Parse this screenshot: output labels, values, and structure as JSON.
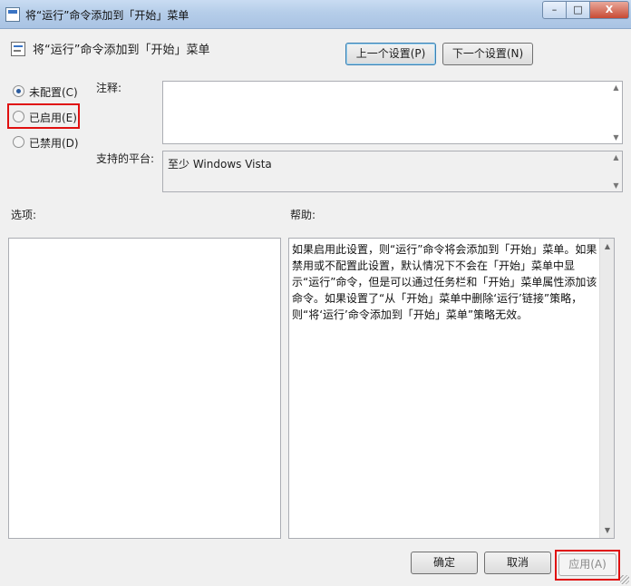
{
  "window": {
    "title": "将“运行”命令添加到「开始」菜单",
    "minimize_label": "–",
    "maximize_label": "□",
    "close_label": "X",
    "icon": "policy-window-icon"
  },
  "header": {
    "policy_title": "将“运行”命令添加到「开始」菜单",
    "policy_icon": "policy-icon",
    "prev_button": "上一个设置(P)",
    "next_button": "下一个设置(N)"
  },
  "state": {
    "options": [
      {
        "label": "未配置(C)",
        "checked": true
      },
      {
        "label": "已启用(E)",
        "checked": false
      },
      {
        "label": "已禁用(D)",
        "checked": false
      }
    ],
    "highlight_color": "#e01010"
  },
  "comment": {
    "label": "注释:",
    "value": ""
  },
  "platform": {
    "label": "支持的平台:",
    "value": "至少 Windows Vista"
  },
  "options_section": {
    "label": "选项:"
  },
  "help_section": {
    "label": "帮助:",
    "text": "如果启用此设置，则“运行”命令将会添加到「开始」菜单。如果禁用或不配置此设置，默认情况下不会在「开始」菜单中显示“运行”命令，但是可以通过任务栏和「开始」菜单属性添加该命令。如果设置了“从「开始」菜单中删除‘运行’链接”策略，则“将‘运行’命令添加到「开始」菜单”策略无效。"
  },
  "footer": {
    "ok_button": "确定",
    "cancel_button": "取消",
    "apply_button": "应用(A)"
  }
}
